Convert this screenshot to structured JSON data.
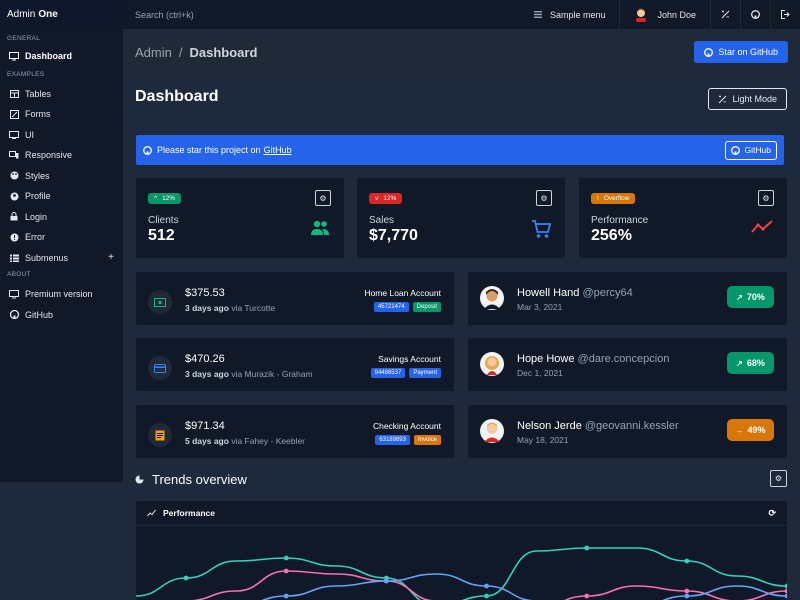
{
  "brand": {
    "prefix": "Admin",
    "name": "One"
  },
  "sidebar": {
    "sections": [
      {
        "label": "GENERAL",
        "items": [
          {
            "label": "Dashboard",
            "icon": "monitor-icon"
          }
        ]
      },
      {
        "label": "EXAMPLES",
        "items": [
          {
            "label": "Tables",
            "icon": "table-icon"
          },
          {
            "label": "Forms",
            "icon": "square-edit-icon"
          },
          {
            "label": "UI",
            "icon": "television-icon"
          },
          {
            "label": "Responsive",
            "icon": "responsive-icon"
          },
          {
            "label": "Styles",
            "icon": "palette-icon"
          },
          {
            "label": "Profile",
            "icon": "account-circle-icon"
          },
          {
            "label": "Login",
            "icon": "lock-icon"
          },
          {
            "label": "Error",
            "icon": "alert-circle-icon"
          },
          {
            "label": "Submenus",
            "icon": "view-list-icon",
            "expander": "+"
          }
        ]
      },
      {
        "label": "ABOUT",
        "items": [
          {
            "label": "Premium version",
            "icon": "monitor-shimmer-icon"
          },
          {
            "label": "GitHub",
            "icon": "github-icon"
          }
        ]
      }
    ]
  },
  "topbar": {
    "search_placeholder": "Search (ctrl+k)",
    "menu_label": "Sample menu",
    "user_name": "John Doe"
  },
  "titlebar": {
    "crumb_root": "Admin",
    "crumb_sep": "/",
    "crumb_current": "Dashboard",
    "star_button": "Star on GitHub"
  },
  "main": {
    "heading": "Dashboard",
    "mode_button": "Light Mode",
    "notice": {
      "text": "Please star this project on",
      "link": "GitHub",
      "button": "GitHub"
    }
  },
  "stats": [
    {
      "badge": "12%",
      "badge_dir": "up",
      "badge_color": "#059669",
      "label": "Clients",
      "value": "512",
      "icon": "account-multiple-icon",
      "icon_color": "#10b981"
    },
    {
      "badge": "12%",
      "badge_dir": "down",
      "badge_color": "#dc2626",
      "label": "Sales",
      "value": "$7,770",
      "icon": "cart-outline-icon",
      "icon_color": "#3b82f6"
    },
    {
      "badge": "Overflow",
      "badge_dir": "alert",
      "badge_color": "#d97706",
      "label": "Performance",
      "value": "256%",
      "icon": "chart-timeline-variant-icon",
      "icon_color": "#ef4444"
    }
  ],
  "transactions": [
    {
      "amount": "$375.53",
      "when": "3 days ago",
      "via": "via Turcotte",
      "account": "Home Loan Account",
      "number": "45721474",
      "type": "Deposit",
      "type_color": "#059669",
      "icon": "cash-icon",
      "icon_color": "#10b981"
    },
    {
      "amount": "$470.26",
      "when": "3 days ago",
      "via": "via Murazik - Graham",
      "account": "Savings Account",
      "number": "94486537",
      "type": "Payment",
      "type_color": "#2563eb",
      "icon": "credit-card-icon",
      "icon_color": "#3b82f6"
    },
    {
      "amount": "$971.34",
      "when": "5 days ago",
      "via": "via Fahey - Keebler",
      "account": "Checking Account",
      "number": "63189893",
      "type": "Invoice",
      "type_color": "#d97706",
      "icon": "receipt-icon",
      "icon_color": "#f59e0b"
    }
  ],
  "clients": [
    {
      "name": "Howell Hand",
      "handle": "@percy64",
      "date": "Mar 3, 2021",
      "progress": "70%",
      "trend": "up",
      "color": "#059669"
    },
    {
      "name": "Hope Howe",
      "handle": "@dare.concepcion",
      "date": "Dec 1, 2021",
      "progress": "68%",
      "trend": "up",
      "color": "#059669"
    },
    {
      "name": "Nelson Jerde",
      "handle": "@geovanni.kessler",
      "date": "May 18, 2021",
      "progress": "49%",
      "trend": "flat",
      "color": "#d97706"
    }
  ],
  "trends": {
    "title": "Trends overview",
    "chart_title": "Performance"
  },
  "chart_data": {
    "type": "line",
    "series": [
      {
        "color": "#2dd4bf",
        "values": [
          20,
          38,
          55,
          58,
          50,
          38,
          10,
          20,
          65,
          68,
          68,
          55,
          40,
          30
        ]
      },
      {
        "color": "#f472b6",
        "values": [
          10,
          15,
          25,
          45,
          42,
          35,
          15,
          5,
          8,
          20,
          30,
          25,
          15,
          25
        ]
      },
      {
        "color": "#60a5fa",
        "values": [
          5,
          8,
          10,
          20,
          30,
          35,
          42,
          30,
          15,
          5,
          10,
          20,
          30,
          20
        ]
      }
    ]
  }
}
